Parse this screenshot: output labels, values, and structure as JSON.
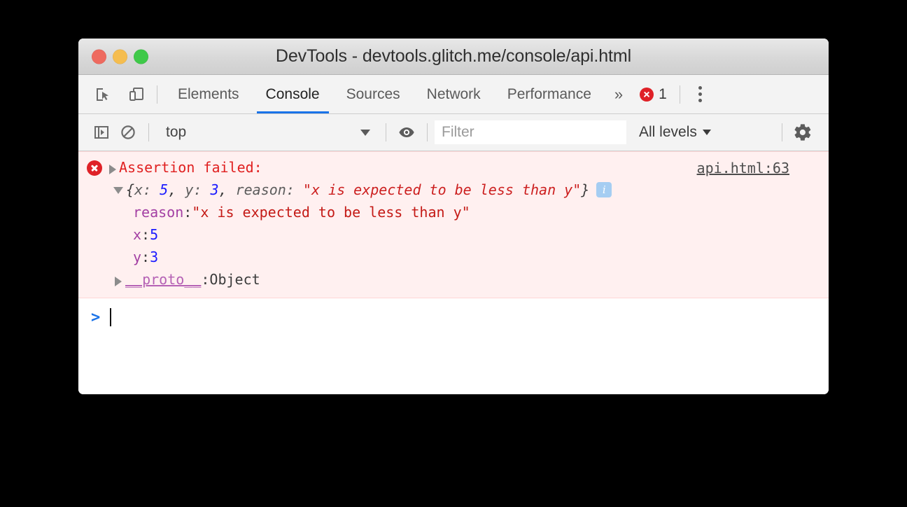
{
  "window": {
    "title": "DevTools - devtools.glitch.me/console/api.html",
    "controls": {
      "close": "close-window",
      "minimize": "minimize-window",
      "zoom": "zoom-window"
    }
  },
  "tabbar": {
    "icons": {
      "inspect": "inspect-element-icon",
      "device": "device-toolbar-icon"
    },
    "tabs": [
      {
        "label": "Elements",
        "active": false
      },
      {
        "label": "Console",
        "active": true
      },
      {
        "label": "Sources",
        "active": false
      },
      {
        "label": "Network",
        "active": false
      },
      {
        "label": "Performance",
        "active": false
      }
    ],
    "more_label": "»",
    "error_count": "1",
    "menu": "main-menu-icon"
  },
  "console_toolbar": {
    "sidebar_toggle": "console-sidebar-icon",
    "clear_console": "clear-console-icon",
    "context": "top",
    "eye": "live-expression-icon",
    "filter": {
      "value": "",
      "placeholder": "Filter"
    },
    "levels": "All levels",
    "settings": "settings-gear-icon"
  },
  "console": {
    "message": {
      "title": "Assertion failed:",
      "source_link": "api.html:63",
      "preview": {
        "open": "{",
        "k1": "x: ",
        "v1": "5",
        "sep1": ", ",
        "k2": "y: ",
        "v2": "3",
        "sep2": ", ",
        "k3": "reason: ",
        "v3": "\"x is expected to be less than y\"",
        "close": "}"
      },
      "info_badge": "i",
      "properties": [
        {
          "name": "reason",
          "colon": ": ",
          "value": "\"x is expected to be less than y\"",
          "kind": "string"
        },
        {
          "name": "x",
          "colon": ": ",
          "value": "5",
          "kind": "number"
        },
        {
          "name": "y",
          "colon": ": ",
          "value": "3",
          "kind": "number"
        },
        {
          "name": "__proto__",
          "colon": ": ",
          "value": "Object",
          "kind": "object"
        }
      ]
    },
    "prompt": {
      "arrow": ">",
      "value": ""
    }
  },
  "colors": {
    "accent": "#1a73e8",
    "error": "#df2127",
    "error_bg": "#fff0f0",
    "string": "#c41a16",
    "number": "#1a1aff",
    "property": "#a33fa3"
  }
}
